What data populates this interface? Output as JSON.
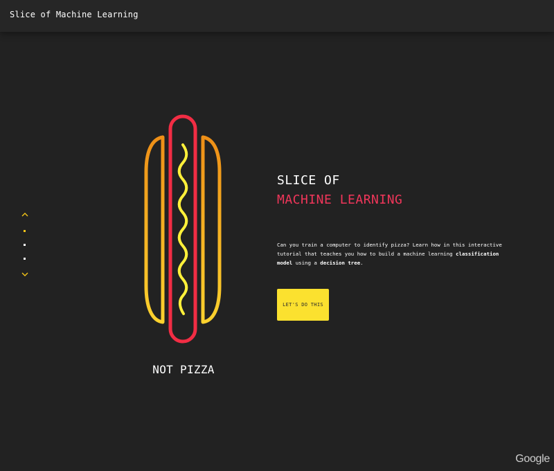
{
  "header": {
    "title": "Slice of Machine Learning"
  },
  "nav": {
    "up_icon": "chevron-up-icon",
    "down_icon": "chevron-down-icon",
    "dot_count": 3,
    "active_dot": 1,
    "accent_color": "#f5c518"
  },
  "illustration": {
    "icon": "hot-dog-icon",
    "label": "NOT PIZZA",
    "colors": {
      "bun_top": "#f0a020",
      "bun_bottom": "#fcc82d",
      "sausage": "#f22d44",
      "mustard": "#fff03a"
    }
  },
  "hero": {
    "title_line1": "SLICE OF",
    "title_line2": "MACHINE LEARNING",
    "title_line2_color": "#f0365a",
    "desc_part1": "Can you train a computer to identify pizza? Learn how in this interactive tutorial that teaches you how to build a machine learning ",
    "desc_bold1": "classification model",
    "desc_part2": " using a ",
    "desc_bold2": "decision tree",
    "desc_part3": "."
  },
  "cta": {
    "label": "LET'S DO THIS",
    "color": "#fbe12f"
  },
  "footer": {
    "logo": "Google"
  }
}
